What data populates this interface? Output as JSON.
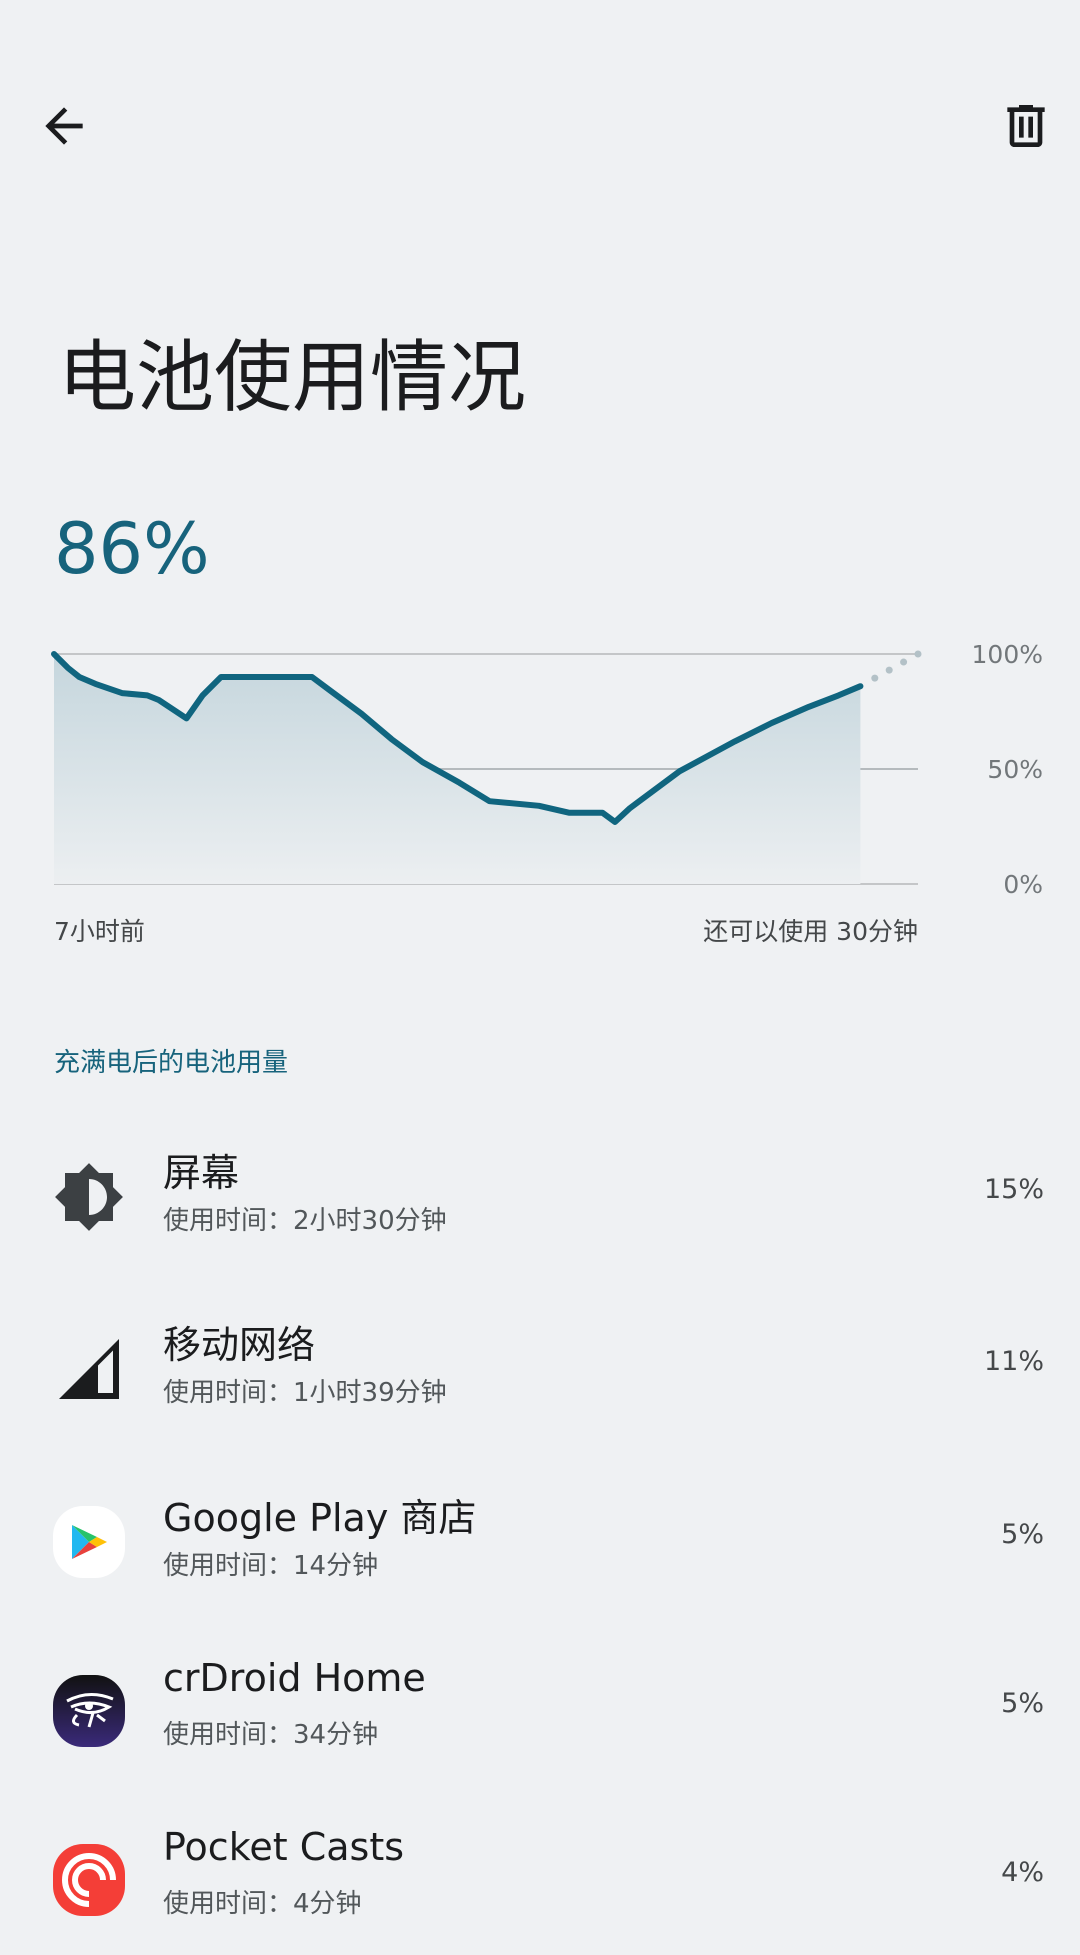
{
  "header": {
    "back_icon": "arrow-left-icon",
    "delete_icon": "trash-icon"
  },
  "title": "电池使用情况",
  "battery_level": "86%",
  "chart_data": {
    "type": "area",
    "x_unit": "hours since start",
    "xlim": [
      0,
      7.5
    ],
    "ylim": [
      0,
      100
    ],
    "y_ticks": [
      "100%",
      "50%",
      "0%"
    ],
    "y_tick_values": [
      100,
      50,
      0
    ],
    "x_labels": {
      "start": "7小时前",
      "end": "还可以使用 30分钟"
    },
    "series": [
      {
        "name": "battery",
        "x": [
          0,
          0.12,
          0.22,
          0.36,
          0.59,
          0.81,
          0.91,
          1.15,
          1.29,
          1.45,
          2.24,
          2.4,
          2.67,
          2.93,
          3.2,
          3.52,
          3.78,
          4.21,
          4.47,
          4.76,
          4.87,
          5.0,
          5.43,
          5.91,
          6.23,
          6.55,
          6.81,
          7.0
        ],
        "y": [
          100,
          94,
          90,
          87,
          83,
          82,
          80,
          72,
          82,
          90,
          90,
          84,
          74,
          63,
          53,
          44,
          36,
          34,
          31,
          31,
          27,
          33,
          49,
          62,
          70,
          77,
          82,
          86
        ]
      }
    ],
    "projection": {
      "x": [
        7.0,
        7.5
      ],
      "y": [
        86,
        100
      ]
    },
    "grid": true,
    "colors": {
      "line": "#10657f",
      "fill": "#c7d8df",
      "projection": "#b3c1c7",
      "grid": "#c4c6c8"
    }
  },
  "section_title": "充满电后的电池用量",
  "items": [
    {
      "title": "屏幕",
      "subtitle": "使用时间：2小时30分钟",
      "percent": "15%",
      "icon": "brightness-icon"
    },
    {
      "title": "移动网络",
      "subtitle": "使用时间：1小时39分钟",
      "percent": "11%",
      "icon": "cellular-signal-icon"
    },
    {
      "title": "Google Play 商店",
      "subtitle": "使用时间：14分钟",
      "percent": "5%",
      "icon": "google-play-icon"
    },
    {
      "title": "crDroid Home",
      "subtitle": "使用时间：34分钟",
      "percent": "5%",
      "icon": "crdroid-home-icon"
    },
    {
      "title": "Pocket Casts",
      "subtitle": "使用时间：4分钟",
      "percent": "4%",
      "icon": "pocket-casts-icon"
    }
  ]
}
